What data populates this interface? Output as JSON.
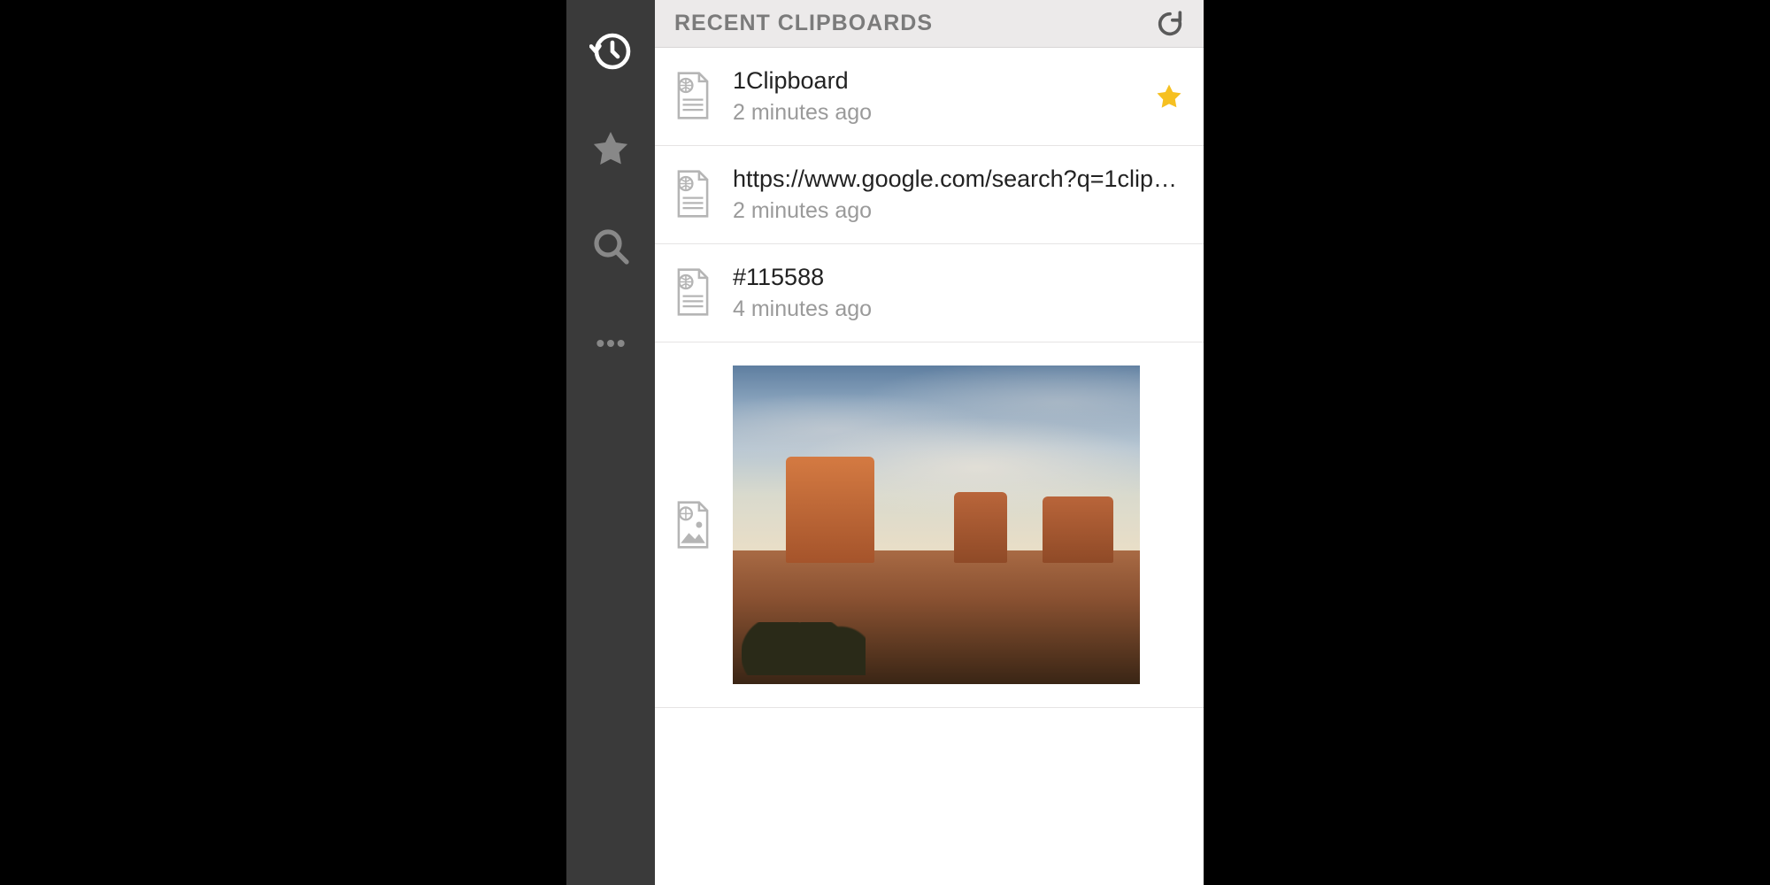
{
  "header": {
    "title": "RECENT CLIPBOARDS"
  },
  "sidebar": {
    "items": [
      {
        "name": "history",
        "active": true
      },
      {
        "name": "favorites",
        "active": false
      },
      {
        "name": "search",
        "active": false
      },
      {
        "name": "more",
        "active": false
      }
    ]
  },
  "clips": [
    {
      "kind": "text",
      "title": "1Clipboard",
      "time": "2 minutes ago",
      "starred": true
    },
    {
      "kind": "text",
      "title": "https://www.google.com/search?q=1clip…",
      "time": "2 minutes ago",
      "starred": false
    },
    {
      "kind": "text",
      "title": "#115588",
      "time": "4 minutes ago",
      "starred": false
    },
    {
      "kind": "image",
      "title": "",
      "time": "",
      "starred": false,
      "image_desc": "desert landscape with rock buttes at dusk"
    }
  ],
  "icons": {
    "history": "history-icon",
    "star": "star-icon",
    "search": "search-icon",
    "more": "more-icon",
    "refresh": "refresh-icon",
    "doc_web": "web-document-icon",
    "doc_image": "web-image-document-icon",
    "fav_star": "favorite-star-icon"
  }
}
